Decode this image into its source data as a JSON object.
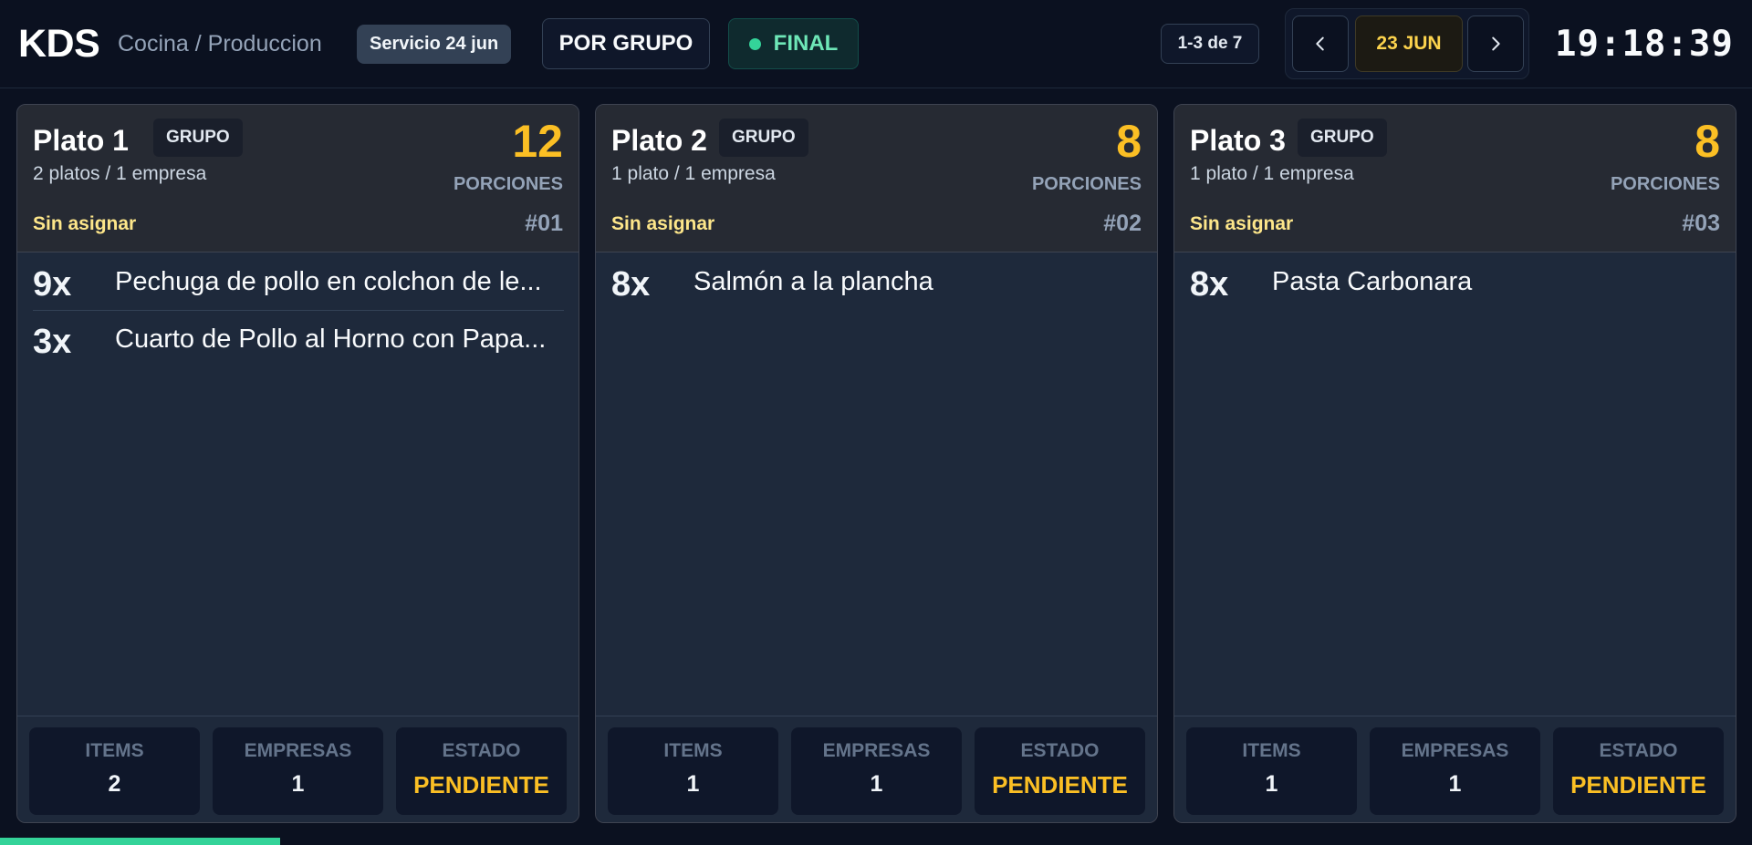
{
  "header": {
    "brand": "KDS",
    "breadcrumb": "Cocina / Produccion",
    "service": "Servicio 24 jun",
    "group_mode": "POR GRUPO",
    "status": "FINAL",
    "page_range": "1-3 de 7",
    "date": "23 JUN",
    "clock": "19:18:39",
    "icons": {
      "prev": "chevron-left-icon",
      "next": "chevron-right-icon"
    }
  },
  "cards": [
    {
      "title": "Plato 1",
      "tag": "GRUPO",
      "subtitle": "2 platos / 1 empresa",
      "portions": "12",
      "portions_label": "PORCIONES",
      "assignee": "Sin asignar",
      "number": "#01",
      "items": [
        {
          "qty": "9x",
          "name": "Pechuga de pollo en colchon de le..."
        },
        {
          "qty": "3x",
          "name": "Cuarto de Pollo al Horno con Papa..."
        }
      ],
      "stats": {
        "items_label": "ITEMS",
        "items": "2",
        "companies_label": "EMPRESAS",
        "companies": "1",
        "state_label": "ESTADO",
        "state": "PENDIENTE"
      }
    },
    {
      "title": "Plato 2",
      "tag": "GRUPO",
      "subtitle": "1 plato / 1 empresa",
      "portions": "8",
      "portions_label": "PORCIONES",
      "assignee": "Sin asignar",
      "number": "#02",
      "items": [
        {
          "qty": "8x",
          "name": "Salmón a la plancha"
        }
      ],
      "stats": {
        "items_label": "ITEMS",
        "items": "1",
        "companies_label": "EMPRESAS",
        "companies": "1",
        "state_label": "ESTADO",
        "state": "PENDIENTE"
      }
    },
    {
      "title": "Plato 3",
      "tag": "GRUPO",
      "subtitle": "1 plato / 1 empresa",
      "portions": "8",
      "portions_label": "PORCIONES",
      "assignee": "Sin asignar",
      "number": "#03",
      "items": [
        {
          "qty": "8x",
          "name": "Pasta Carbonara"
        }
      ],
      "stats": {
        "items_label": "ITEMS",
        "items": "1",
        "companies_label": "EMPRESAS",
        "companies": "1",
        "state_label": "ESTADO",
        "state": "PENDIENTE"
      }
    }
  ],
  "colors": {
    "accent": "#fbbf24",
    "success": "#34d399",
    "background": "#0b1120",
    "card": "#1e293b"
  },
  "progress": {
    "fraction": 0.16
  }
}
